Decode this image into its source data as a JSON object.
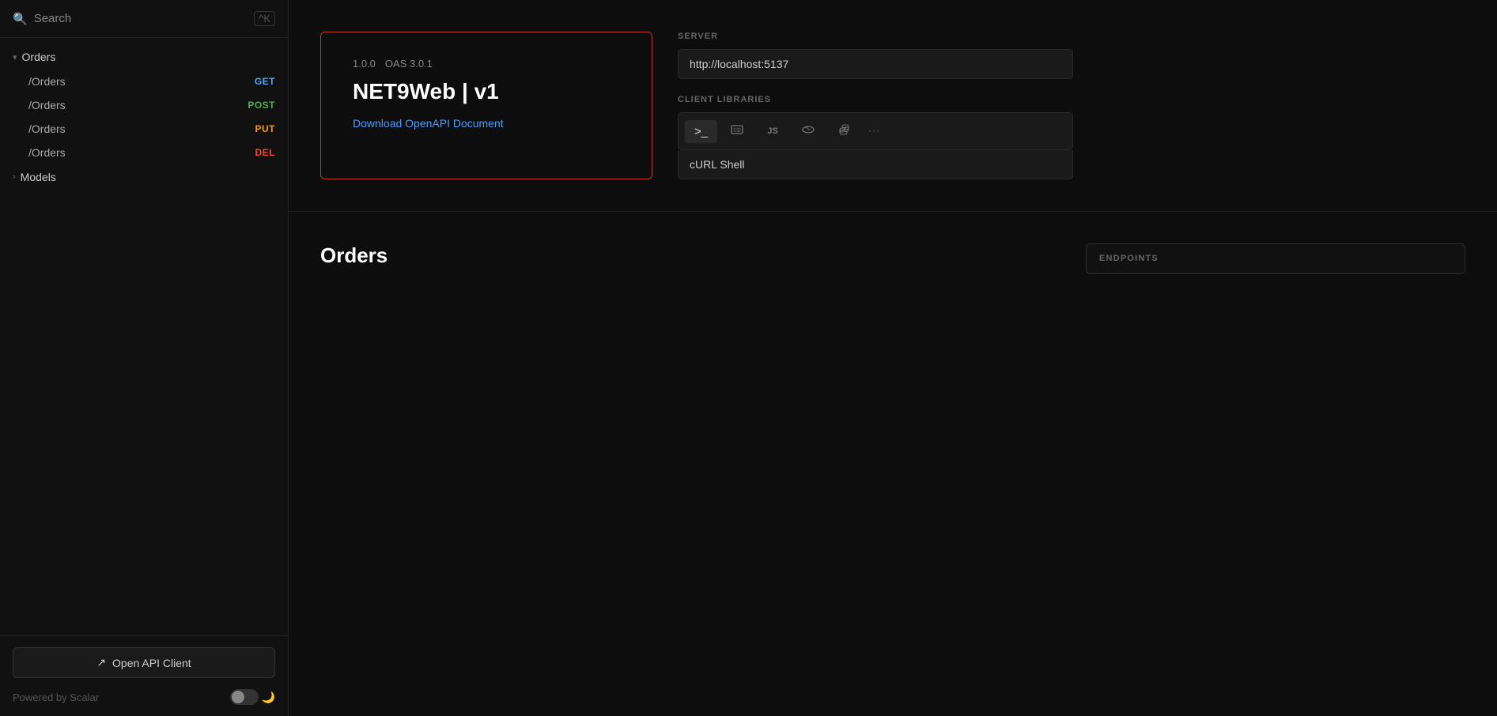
{
  "sidebar": {
    "search": {
      "placeholder": "Search",
      "shortcut": "^K"
    },
    "nav": {
      "groups": [
        {
          "label": "Orders",
          "expanded": true,
          "items": [
            {
              "path": "/Orders",
              "method": "GET",
              "method_class": "method-get"
            },
            {
              "path": "/Orders",
              "method": "POST",
              "method_class": "method-post"
            },
            {
              "path": "/Orders",
              "method": "PUT",
              "method_class": "method-put"
            },
            {
              "path": "/Orders",
              "method": "DEL",
              "method_class": "method-del"
            }
          ]
        },
        {
          "label": "Models",
          "expanded": false,
          "items": []
        }
      ]
    },
    "footer": {
      "open_api_btn": "Open API Client",
      "powered_by": "Powered by Scalar"
    }
  },
  "main": {
    "api_info": {
      "version": "1.0.0",
      "oas": "OAS 3.0.1",
      "title": "NET9Web | v1",
      "download_link": "Download OpenAPI Document"
    },
    "server": {
      "label": "SERVER",
      "value": "http://localhost:5137"
    },
    "client_libraries": {
      "label": "CLIENT LIBRARIES",
      "tabs": [
        {
          "icon": ">_",
          "label": "cURL Shell",
          "active": true
        },
        {
          "icon": "📋",
          "label": "HTTP"
        },
        {
          "icon": "JS",
          "label": "Node.js"
        },
        {
          "icon": "🐘",
          "label": "PHP"
        },
        {
          "icon": "🐍",
          "label": "Python"
        },
        {
          "icon": "...",
          "label": "More"
        }
      ],
      "active_label": "cURL Shell"
    },
    "orders_section": {
      "title": "Orders",
      "endpoints_label": "ENDPOINTS"
    }
  }
}
